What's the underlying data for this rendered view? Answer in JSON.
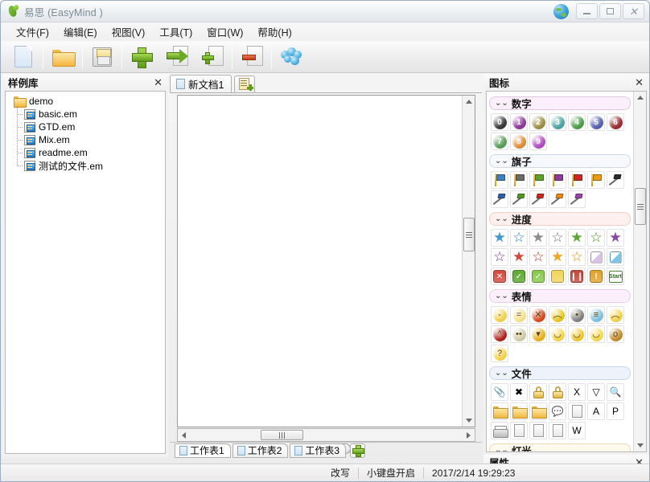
{
  "window": {
    "title": "易思 (EasyMind )",
    "logo_icon": "plant-leaf-logo",
    "globe_icon": "globe-icon",
    "minimize_label": "–",
    "maximize_label": "□",
    "close_label": "✕"
  },
  "menubar": {
    "items": [
      {
        "label": "文件(F)",
        "name": "menu-file"
      },
      {
        "label": "编辑(E)",
        "name": "menu-edit"
      },
      {
        "label": "视图(V)",
        "name": "menu-view"
      },
      {
        "label": "工具(T)",
        "name": "menu-tools"
      },
      {
        "label": "窗口(W)",
        "name": "menu-window"
      },
      {
        "label": "帮助(H)",
        "name": "menu-help"
      }
    ]
  },
  "toolbar": {
    "buttons": [
      {
        "name": "new-document-button",
        "icon": "new-page-icon"
      },
      {
        "name": "open-document-button",
        "icon": "open-folder-icon"
      },
      {
        "name": "save-document-button",
        "icon": "floppy-save-icon"
      },
      {
        "name": "add-node-button",
        "icon": "green-plus-icon"
      },
      {
        "name": "add-sibling-node-button",
        "icon": "green-arrow-page-icon"
      },
      {
        "name": "add-child-node-button",
        "icon": "page-plus-icon"
      },
      {
        "name": "delete-node-button",
        "icon": "page-minus-icon"
      },
      {
        "name": "share-group-button",
        "icon": "blue-people-icon"
      }
    ]
  },
  "sample_panel": {
    "title": "样例库",
    "close_icon": "close-icon",
    "root": {
      "label": "demo",
      "icon": "folder-icon"
    },
    "files": [
      {
        "label": "basic.em",
        "icon": "em-file-icon"
      },
      {
        "label": "GTD.em",
        "icon": "em-file-icon"
      },
      {
        "label": "Mix.em",
        "icon": "em-file-icon"
      },
      {
        "label": "readme.em",
        "icon": "em-file-icon"
      },
      {
        "label": "测试的文件.em",
        "icon": "em-file-icon"
      }
    ]
  },
  "document": {
    "tabs": [
      {
        "label": "新文档1",
        "icon": "page-icon",
        "active": true
      }
    ],
    "new_tab_button": {
      "name": "new-document-tab-button",
      "icon": "new-document-icon"
    },
    "collapse_button": {
      "name": "collapse-panel-button",
      "icon": "chevron-up-icon"
    },
    "vscroll": {
      "up_icon": "scroll-up-arrow",
      "down_icon": "scroll-down-arrow"
    },
    "hscroll": {
      "left_icon": "scroll-left-arrow",
      "right_icon": "scroll-right-arrow"
    },
    "sheet_tabs": [
      {
        "label": "工作表1",
        "active": true
      },
      {
        "label": "工作表2",
        "active": false
      },
      {
        "label": "工作表3",
        "active": false
      }
    ],
    "add_sheet_button": {
      "name": "add-sheet-button",
      "icon": "green-plus-icon"
    }
  },
  "icons_panel": {
    "title": "图标",
    "close_icon": "close-icon",
    "categories": [
      {
        "name": "numbers",
        "label": "数字",
        "header_bg": "#fbeffb",
        "header_border": "#e0c6e0",
        "items": [
          {
            "name": "number-0",
            "glyph": "0",
            "color": "#3b3b3b"
          },
          {
            "name": "number-1",
            "glyph": "1",
            "color": "#8e3a9c"
          },
          {
            "name": "number-2",
            "glyph": "2",
            "color": "#a09146"
          },
          {
            "name": "number-3",
            "glyph": "3",
            "color": "#4fa6a6"
          },
          {
            "name": "number-4",
            "glyph": "4",
            "color": "#4f9f4a"
          },
          {
            "name": "number-5",
            "glyph": "5",
            "color": "#5a63b5"
          },
          {
            "name": "number-6",
            "glyph": "6",
            "color": "#9c2f33"
          },
          {
            "name": "number-7",
            "glyph": "7",
            "color": "#5aa05a"
          },
          {
            "name": "number-8",
            "glyph": "8",
            "color": "#e2903a"
          },
          {
            "name": "number-9",
            "glyph": "9",
            "color": "#b44fc4"
          }
        ]
      },
      {
        "name": "flags",
        "label": "旗子",
        "header_bg": "#f6f8fc",
        "header_border": "#cfd8e6",
        "items": [
          {
            "name": "flag-blue",
            "type": "flag",
            "color": "#3f7fc4"
          },
          {
            "name": "flag-gray",
            "type": "flag",
            "color": "#6b6b6b"
          },
          {
            "name": "flag-green",
            "type": "flag",
            "color": "#5ca22a"
          },
          {
            "name": "flag-purple",
            "type": "flag",
            "color": "#8e3a9c"
          },
          {
            "name": "flag-red",
            "type": "flag",
            "color": "#cc2a22"
          },
          {
            "name": "flag-orange",
            "type": "flag",
            "color": "#eb9a17"
          },
          {
            "name": "waving-flag-black",
            "type": "flagw",
            "color": "#2b2b2b"
          },
          {
            "name": "waving-flag-blue",
            "type": "flagw",
            "color": "#2f5fae"
          },
          {
            "name": "waving-flag-green",
            "type": "flagw",
            "color": "#4f9a22"
          },
          {
            "name": "waving-flag-red",
            "type": "flagw",
            "color": "#c72b20"
          },
          {
            "name": "waving-flag-orange",
            "type": "flagw",
            "color": "#e88a14"
          },
          {
            "name": "waving-flag-purple",
            "type": "flagw",
            "color": "#9b44ab"
          }
        ]
      },
      {
        "name": "progress",
        "label": "进度",
        "header_bg": "#fdf0ee",
        "header_border": "#f0cfc9",
        "items": [
          {
            "name": "star-blue-full",
            "type": "star",
            "glyph": "★",
            "color": "#3f9bd6"
          },
          {
            "name": "star-blue-half",
            "type": "star",
            "glyph": "☆",
            "color": "#3f9bd6"
          },
          {
            "name": "star-gray-full",
            "type": "star",
            "glyph": "★",
            "color": "#8d8d8d"
          },
          {
            "name": "star-gray-half",
            "type": "star",
            "glyph": "☆",
            "color": "#8d8d8d"
          },
          {
            "name": "star-green-full",
            "type": "star",
            "glyph": "★",
            "color": "#5ba82e"
          },
          {
            "name": "star-green-half",
            "type": "star",
            "glyph": "☆",
            "color": "#5ba82e"
          },
          {
            "name": "star-purple-full",
            "type": "star",
            "glyph": "★",
            "color": "#8c46a8"
          },
          {
            "name": "star-purple-half",
            "type": "star",
            "glyph": "☆",
            "color": "#8c46a8"
          },
          {
            "name": "star-red-full",
            "type": "star",
            "glyph": "★",
            "color": "#d2483c"
          },
          {
            "name": "star-red-half",
            "type": "star",
            "glyph": "☆",
            "color": "#d2483c"
          },
          {
            "name": "star-orange-full",
            "type": "star",
            "glyph": "★",
            "color": "#f0a81e"
          },
          {
            "name": "star-orange-half",
            "type": "star",
            "glyph": "☆",
            "color": "#f0a81e"
          },
          {
            "name": "progress-quarter-purple",
            "type": "rsq",
            "color": "#d9c2e6"
          },
          {
            "name": "progress-half-blue",
            "type": "rsq",
            "color": "#7ec4ea"
          },
          {
            "name": "status-cancel",
            "type": "badge",
            "glyph": "✕",
            "color": "#d2483c"
          },
          {
            "name": "status-check-green",
            "type": "badge",
            "glyph": "✓",
            "color": "#5ba82e"
          },
          {
            "name": "status-check-light",
            "type": "badge",
            "glyph": "✓",
            "color": "#86c94a"
          },
          {
            "name": "status-half-yellow",
            "type": "badge",
            "glyph": "",
            "color": "#f2d45a"
          },
          {
            "name": "status-pause",
            "type": "badge",
            "glyph": "❙❙",
            "color": "#c2483c"
          },
          {
            "name": "status-warning",
            "type": "badge",
            "glyph": "!",
            "color": "#e0a32a"
          },
          {
            "name": "status-start",
            "type": "start",
            "glyph": "Start",
            "color": "#4a8a30"
          }
        ]
      },
      {
        "name": "emotions",
        "label": "表情",
        "header_bg": "#fbeffb",
        "header_border": "#e6cfe6",
        "items": [
          {
            "name": "emoji-neutral",
            "glyph": "-",
            "color": "#f2d24a"
          },
          {
            "name": "emoji-flat",
            "glyph": "=",
            "color": "#f5e08a"
          },
          {
            "name": "emoji-angry",
            "glyph": "✕",
            "color": "#d8481e"
          },
          {
            "name": "emoji-sad",
            "glyph": "︵",
            "color": "#e8c51e"
          },
          {
            "name": "emoji-bomb",
            "glyph": "•",
            "color": "#808080"
          },
          {
            "name": "emoji-cold",
            "glyph": "≡",
            "color": "#7cc0e0"
          },
          {
            "name": "emoji-cry",
            "glyph": "︵",
            "color": "#f2d24a"
          },
          {
            "name": "emoji-devil",
            "glyph": "^",
            "color": "#b0201c"
          },
          {
            "name": "emoji-nerd",
            "glyph": "••",
            "color": "#cfcaa8"
          },
          {
            "name": "emoji-tongue",
            "glyph": "▾",
            "color": "#eab01e"
          },
          {
            "name": "emoji-wink",
            "glyph": "◡",
            "color": "#f6d44e"
          },
          {
            "name": "emoji-silly",
            "glyph": "◡",
            "color": "#f0c72e"
          },
          {
            "name": "emoji-smile",
            "glyph": "◡",
            "color": "#f5d84e"
          },
          {
            "name": "emoji-surprise",
            "glyph": "o",
            "color": "#c48a2a"
          },
          {
            "name": "emoji-question",
            "glyph": "?",
            "color": "#f2d24a"
          }
        ]
      },
      {
        "name": "files",
        "label": "文件",
        "header_bg": "#eef3fb",
        "header_border": "#c9d6ea",
        "items": [
          {
            "name": "attachment-clip-icon",
            "glyph": "📎"
          },
          {
            "name": "no-entry-icon",
            "glyph": "✖"
          },
          {
            "name": "unlock-icon",
            "glyph": "🔓"
          },
          {
            "name": "lock-icon",
            "glyph": "🔒"
          },
          {
            "name": "excel-file-icon",
            "glyph": "X"
          },
          {
            "name": "filter-icon",
            "glyph": "▽"
          },
          {
            "name": "search-icon",
            "glyph": "🔍"
          },
          {
            "name": "open-folder-icon",
            "glyph": ""
          },
          {
            "name": "closed-folder-icon",
            "glyph": ""
          },
          {
            "name": "folder-open-arrow-icon",
            "glyph": ""
          },
          {
            "name": "comment-bubble-icon",
            "glyph": "💬"
          },
          {
            "name": "blank-page-icon",
            "glyph": ""
          },
          {
            "name": "pdf-file-icon",
            "glyph": "A"
          },
          {
            "name": "ppt-file-icon",
            "glyph": "P"
          },
          {
            "name": "printer-icon",
            "glyph": ""
          },
          {
            "name": "save-disk-icon",
            "glyph": ""
          },
          {
            "name": "edit-disk-icon",
            "glyph": ""
          },
          {
            "name": "notes-page-icon",
            "glyph": ""
          },
          {
            "name": "word-file-icon",
            "glyph": "W"
          }
        ]
      },
      {
        "name": "lights",
        "label": "灯光",
        "header_bg": "#fdfaed",
        "header_border": "#e4dcb4",
        "items": [
          {
            "name": "bulb-green-icon",
            "color": "#bfe07a"
          },
          {
            "name": "bulb-white-icon",
            "color": "#e6eef5"
          },
          {
            "name": "bulb-yellow-icon",
            "color": "#f2c83a"
          },
          {
            "name": "traffic-light-red-icon",
            "color": "#d02a22"
          },
          {
            "name": "traffic-light-off-icon",
            "color": "#6b6b6b"
          },
          {
            "name": "traffic-light-amber-icon",
            "color": "#d94a22"
          },
          {
            "name": "traffic-light-yellow-icon",
            "color": "#e8b01e"
          }
        ]
      }
    ]
  },
  "properties_panel": {
    "title": "属性",
    "close_icon": "close-icon"
  },
  "statusbar": {
    "overwrite_mode": "改写",
    "numpad_state": "小键盘开启",
    "datetime": "2017/2/14 19:29:23"
  }
}
